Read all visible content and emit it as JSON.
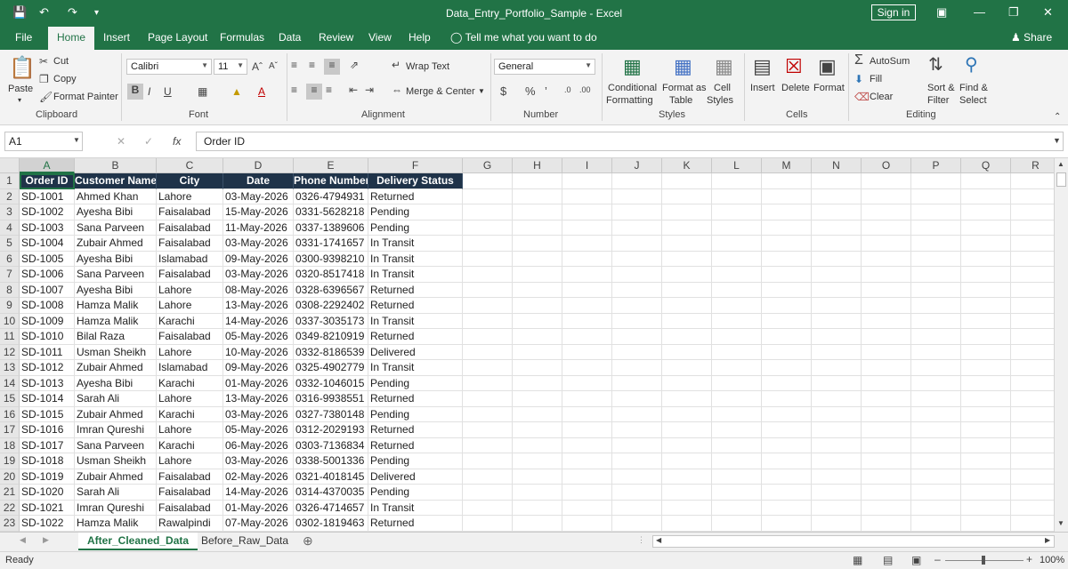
{
  "window": {
    "title": "Data_Entry_Portfolio_Sample  -  Excel",
    "signin": "Sign in"
  },
  "tabs": [
    "File",
    "Home",
    "Insert",
    "Page Layout",
    "Formulas",
    "Data",
    "Review",
    "View",
    "Help"
  ],
  "tell_me": "Tell me what you want to do",
  "share": "Share",
  "ribbon": {
    "clipboard": {
      "paste": "Paste",
      "cut": "Cut",
      "copy": "Copy",
      "format_painter": "Format Painter",
      "label": "Clipboard"
    },
    "font": {
      "name": "Calibri",
      "size": "11",
      "label": "Font"
    },
    "alignment": {
      "wrap": "Wrap Text",
      "merge": "Merge & Center",
      "label": "Alignment"
    },
    "number": {
      "format": "General",
      "label": "Number"
    },
    "styles": {
      "cond1": "Conditional",
      "cond2": "Formatting",
      "fmt1": "Format as",
      "fmt2": "Table",
      "cell1": "Cell",
      "cell2": "Styles",
      "label": "Styles"
    },
    "cells": {
      "insert": "Insert",
      "delete": "Delete",
      "format": "Format",
      "label": "Cells"
    },
    "editing": {
      "autosum": "AutoSum",
      "fill": "Fill",
      "clear": "Clear",
      "sort1": "Sort &",
      "sort2": "Filter",
      "find1": "Find &",
      "find2": "Select",
      "label": "Editing"
    }
  },
  "formula_bar": {
    "name_box": "A1",
    "fx": "fx",
    "value": "Order ID"
  },
  "columns": [
    "A",
    "B",
    "C",
    "D",
    "E",
    "F",
    "G",
    "H",
    "I",
    "J",
    "K",
    "L",
    "M",
    "N",
    "O",
    "P",
    "Q",
    "R"
  ],
  "table_headers": [
    "Order ID",
    "Customer Name",
    "City",
    "Date",
    "Phone Number",
    "Delivery Status"
  ],
  "rows": [
    [
      "SD-1001",
      "Ahmed Khan",
      "Lahore",
      "03-May-2026",
      "0326-4794931",
      "Returned"
    ],
    [
      "SD-1002",
      "Ayesha Bibi",
      "Faisalabad",
      "15-May-2026",
      "0331-5628218",
      "Pending"
    ],
    [
      "SD-1003",
      "Sana Parveen",
      "Faisalabad",
      "11-May-2026",
      "0337-1389606",
      "Pending"
    ],
    [
      "SD-1004",
      "Zubair Ahmed",
      "Faisalabad",
      "03-May-2026",
      "0331-1741657",
      "In Transit"
    ],
    [
      "SD-1005",
      "Ayesha Bibi",
      "Islamabad",
      "09-May-2026",
      "0300-9398210",
      "In Transit"
    ],
    [
      "SD-1006",
      "Sana Parveen",
      "Faisalabad",
      "03-May-2026",
      "0320-8517418",
      "In Transit"
    ],
    [
      "SD-1007",
      "Ayesha Bibi",
      "Lahore",
      "08-May-2026",
      "0328-6396567",
      "Returned"
    ],
    [
      "SD-1008",
      "Hamza Malik",
      "Lahore",
      "13-May-2026",
      "0308-2292402",
      "Returned"
    ],
    [
      "SD-1009",
      "Hamza Malik",
      "Karachi",
      "14-May-2026",
      "0337-3035173",
      "In Transit"
    ],
    [
      "SD-1010",
      "Bilal Raza",
      "Faisalabad",
      "05-May-2026",
      "0349-8210919",
      "Returned"
    ],
    [
      "SD-1011",
      "Usman Sheikh",
      "Lahore",
      "10-May-2026",
      "0332-8186539",
      "Delivered"
    ],
    [
      "SD-1012",
      "Zubair Ahmed",
      "Islamabad",
      "09-May-2026",
      "0325-4902779",
      "In Transit"
    ],
    [
      "SD-1013",
      "Ayesha Bibi",
      "Karachi",
      "01-May-2026",
      "0332-1046015",
      "Pending"
    ],
    [
      "SD-1014",
      "Sarah Ali",
      "Lahore",
      "13-May-2026",
      "0316-9938551",
      "Returned"
    ],
    [
      "SD-1015",
      "Zubair Ahmed",
      "Karachi",
      "03-May-2026",
      "0327-7380148",
      "Pending"
    ],
    [
      "SD-1016",
      "Imran Qureshi",
      "Lahore",
      "05-May-2026",
      "0312-2029193",
      "Returned"
    ],
    [
      "SD-1017",
      "Sana Parveen",
      "Karachi",
      "06-May-2026",
      "0303-7136834",
      "Returned"
    ],
    [
      "SD-1018",
      "Usman Sheikh",
      "Lahore",
      "03-May-2026",
      "0338-5001336",
      "Pending"
    ],
    [
      "SD-1019",
      "Zubair Ahmed",
      "Faisalabad",
      "02-May-2026",
      "0321-4018145",
      "Delivered"
    ],
    [
      "SD-1020",
      "Sarah Ali",
      "Faisalabad",
      "14-May-2026",
      "0314-4370035",
      "Pending"
    ],
    [
      "SD-1021",
      "Imran Qureshi",
      "Faisalabad",
      "01-May-2026",
      "0326-4714657",
      "In Transit"
    ],
    [
      "SD-1022",
      "Hamza Malik",
      "Rawalpindi",
      "07-May-2026",
      "0302-1819463",
      "Returned"
    ]
  ],
  "sheets": [
    "After_Cleaned_Data",
    "Before_Raw_Data"
  ],
  "status": {
    "ready": "Ready",
    "zoom": "100%"
  },
  "colors": {
    "excel_green": "#217346",
    "header_fill": "#1f3349"
  }
}
